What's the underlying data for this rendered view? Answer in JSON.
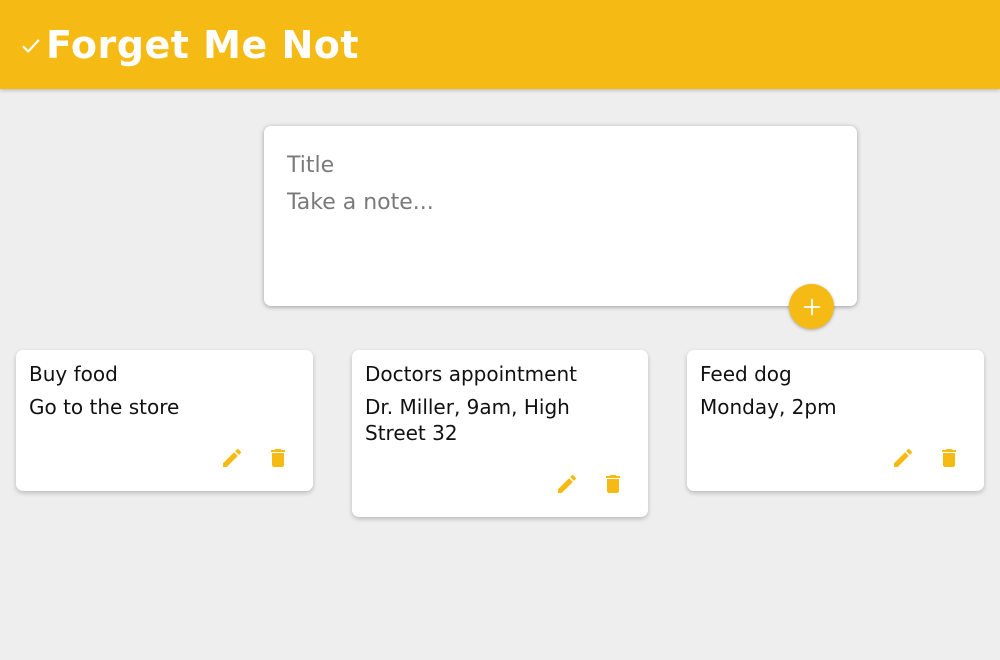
{
  "app": {
    "title": "Forget Me Not",
    "accent_color": "#f5ba13"
  },
  "composer": {
    "title_placeholder": "Title",
    "content_placeholder": "Take a note...",
    "add_icon": "plus-icon"
  },
  "notes": [
    {
      "title": "Buy food",
      "content": "Go to the store"
    },
    {
      "title": "Doctors appointment",
      "content": "Dr. Miller, 9am, High Street 32"
    },
    {
      "title": "Feed dog",
      "content": "Monday, 2pm"
    }
  ],
  "icons": {
    "logo": "check-icon",
    "edit": "pencil-icon",
    "delete": "trash-icon"
  }
}
